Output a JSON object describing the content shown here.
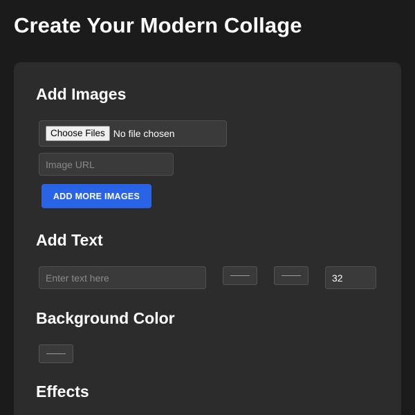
{
  "page": {
    "title": "Create Your Modern Collage"
  },
  "images_section": {
    "title": "Add Images",
    "choose_files_label": "Choose Files",
    "file_status": "No file chosen",
    "url_placeholder": "Image URL",
    "url_value": "",
    "add_more_label": "ADD MORE IMAGES",
    "add_more_color": "#2a64e6"
  },
  "text_section": {
    "title": "Add Text",
    "text_placeholder": "Enter text here",
    "text_value": "",
    "font_size_value": "32"
  },
  "background_section": {
    "title": "Background Color"
  },
  "effects_section": {
    "title": "Effects"
  },
  "colors": {
    "page_background": "#1b1b1b",
    "panel_background": "#2c2c2c",
    "input_background": "#3a3a3a",
    "accent": "#2a64e6"
  }
}
